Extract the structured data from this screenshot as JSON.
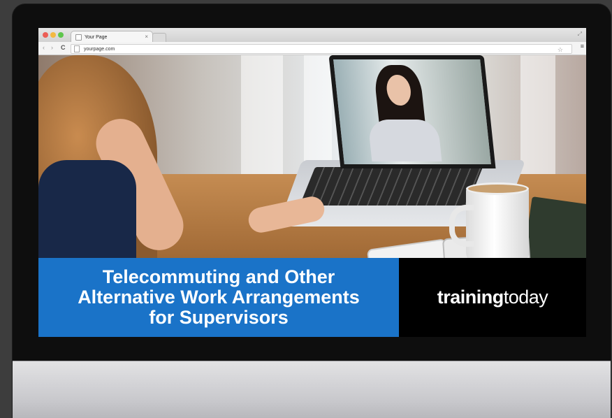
{
  "browser": {
    "tab_title": "Your Page",
    "tab_close": "×",
    "url": "yourpage.com",
    "nav": {
      "back": "‹",
      "forward": "›",
      "reload": "C"
    },
    "icons": {
      "star": "☆",
      "menu": "≡",
      "resize": "⤢"
    }
  },
  "slide": {
    "title": "Telecommuting and Other\nAlternative Work Arrangements\nfor Supervisors",
    "brand_bold": "training",
    "brand_light": "today",
    "title_bg_color": "#1a73c8",
    "brand_bg_color": "#000000"
  }
}
